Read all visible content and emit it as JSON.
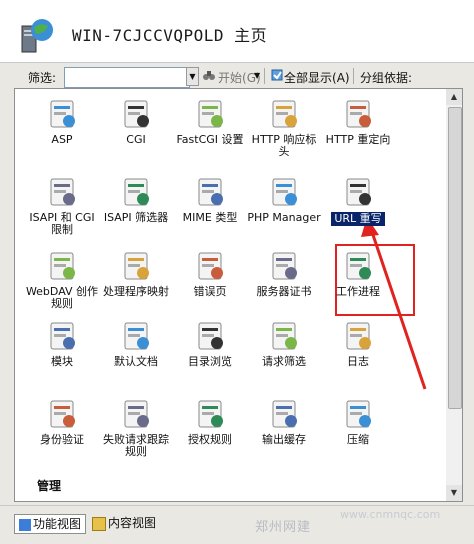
{
  "header": {
    "title": "WIN-7CJCCVQPOLD 主页"
  },
  "toolbar": {
    "filter_label": "筛选:",
    "filter_value": "",
    "start_label": "开始",
    "start_key": "(G)",
    "show_all_label": "全部显示",
    "show_all_key": "(A)",
    "group_by_label": "分组依据:"
  },
  "icons": [
    {
      "label": "ASP",
      "icon": "asp-icon"
    },
    {
      "label": "CGI",
      "icon": "cgi-icon"
    },
    {
      "label": "FastCGI 设置",
      "icon": "fastcgi-icon"
    },
    {
      "label": "HTTP 响应标头",
      "icon": "http-headers-icon"
    },
    {
      "label": "HTTP 重定向",
      "icon": "http-redirect-icon"
    },
    {
      "label": "ISAPI 和 CGI 限制",
      "icon": "isapi-cgi-icon"
    },
    {
      "label": "ISAPI 筛选器",
      "icon": "isapi-filter-icon"
    },
    {
      "label": "MIME 类型",
      "icon": "mime-icon"
    },
    {
      "label": "PHP Manager",
      "icon": "php-icon"
    },
    {
      "label": "URL 重写",
      "icon": "url-rewrite-icon"
    },
    {
      "label": "WebDAV 创作规则",
      "icon": "webdav-icon"
    },
    {
      "label": "处理程序映射",
      "icon": "handler-icon"
    },
    {
      "label": "错误页",
      "icon": "error-page-icon"
    },
    {
      "label": "服务器证书",
      "icon": "certificate-icon"
    },
    {
      "label": "工作进程",
      "icon": "worker-icon"
    },
    {
      "label": "模块",
      "icon": "module-icon"
    },
    {
      "label": "默认文档",
      "icon": "default-doc-icon"
    },
    {
      "label": "目录浏览",
      "icon": "dir-browse-icon"
    },
    {
      "label": "请求筛选",
      "icon": "request-filter-icon"
    },
    {
      "label": "日志",
      "icon": "log-icon"
    },
    {
      "label": "身份验证",
      "icon": "auth-icon"
    },
    {
      "label": "失败请求跟踪规则",
      "icon": "failed-trace-icon"
    },
    {
      "label": "授权规则",
      "icon": "authz-icon"
    },
    {
      "label": "输出缓存",
      "icon": "output-cache-icon"
    },
    {
      "label": "压缩",
      "icon": "compress-icon"
    }
  ],
  "group_label": "管理",
  "tabs": [
    {
      "label": "功能视图",
      "active": true
    },
    {
      "label": "内容视图",
      "active": false
    }
  ],
  "watermark": "郑州网建",
  "watermark_site": "www.cnmnqc.com",
  "colors": {
    "selection": "#0a246a",
    "highlight": "#e0231f",
    "arrow": "#e0231f"
  }
}
